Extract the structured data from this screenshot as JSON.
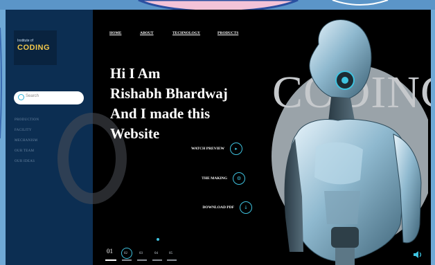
{
  "logo": {
    "small": "Institute of",
    "big": "CODING"
  },
  "search": {
    "placeholder": "Search"
  },
  "sidebar": {
    "items": [
      "PRODUCTION",
      "FACILITY",
      "MECHANISM",
      "OUR TEAM",
      "OUR IDEAS"
    ]
  },
  "nav": {
    "items": [
      "HOME",
      "ABOUT",
      "TECHNOLOGY",
      "PRODUCTS"
    ]
  },
  "hero": {
    "lines": [
      "Hi I Am",
      "Rishabh Bhardwaj",
      "And I made this",
      "Website"
    ],
    "bg_word": "CODING"
  },
  "actions": [
    {
      "label": "WATCH PREVIEW",
      "icon": "play-icon"
    },
    {
      "label": "THE MAKING",
      "icon": "gear-icon"
    },
    {
      "label": "DOWNLOAD PDF",
      "icon": "download-icon"
    }
  ],
  "pagination": {
    "current": "01",
    "pages": [
      "02",
      "03",
      "04",
      "05"
    ]
  },
  "colors": {
    "sidebar": "#0c2e52",
    "accent": "#3fc3e0",
    "background": "#000000",
    "outer": "#6fa9d6"
  }
}
